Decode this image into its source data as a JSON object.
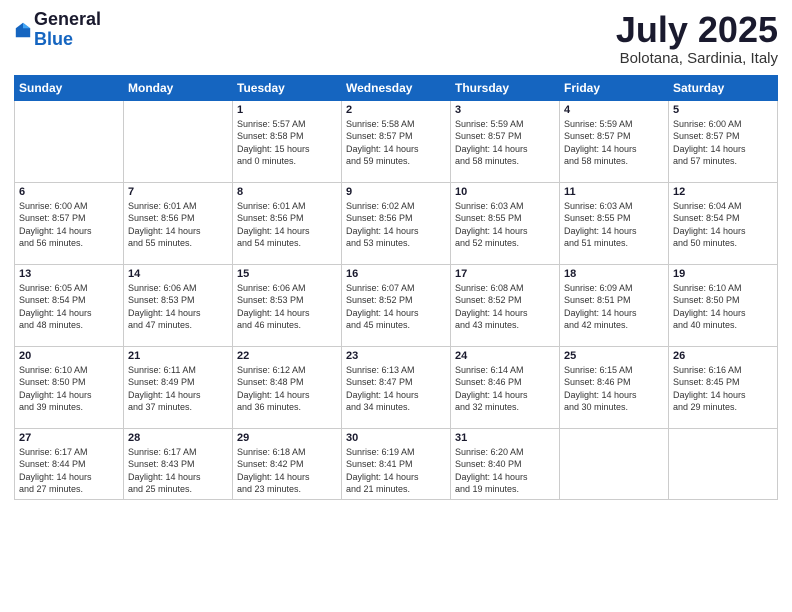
{
  "logo": {
    "general": "General",
    "blue": "Blue"
  },
  "title": "July 2025",
  "subtitle": "Bolotana, Sardinia, Italy",
  "weekdays": [
    "Sunday",
    "Monday",
    "Tuesday",
    "Wednesday",
    "Thursday",
    "Friday",
    "Saturday"
  ],
  "weeks": [
    [
      {
        "day": "",
        "info": ""
      },
      {
        "day": "",
        "info": ""
      },
      {
        "day": "1",
        "info": "Sunrise: 5:57 AM\nSunset: 8:58 PM\nDaylight: 15 hours\nand 0 minutes."
      },
      {
        "day": "2",
        "info": "Sunrise: 5:58 AM\nSunset: 8:57 PM\nDaylight: 14 hours\nand 59 minutes."
      },
      {
        "day": "3",
        "info": "Sunrise: 5:59 AM\nSunset: 8:57 PM\nDaylight: 14 hours\nand 58 minutes."
      },
      {
        "day": "4",
        "info": "Sunrise: 5:59 AM\nSunset: 8:57 PM\nDaylight: 14 hours\nand 58 minutes."
      },
      {
        "day": "5",
        "info": "Sunrise: 6:00 AM\nSunset: 8:57 PM\nDaylight: 14 hours\nand 57 minutes."
      }
    ],
    [
      {
        "day": "6",
        "info": "Sunrise: 6:00 AM\nSunset: 8:57 PM\nDaylight: 14 hours\nand 56 minutes."
      },
      {
        "day": "7",
        "info": "Sunrise: 6:01 AM\nSunset: 8:56 PM\nDaylight: 14 hours\nand 55 minutes."
      },
      {
        "day": "8",
        "info": "Sunrise: 6:01 AM\nSunset: 8:56 PM\nDaylight: 14 hours\nand 54 minutes."
      },
      {
        "day": "9",
        "info": "Sunrise: 6:02 AM\nSunset: 8:56 PM\nDaylight: 14 hours\nand 53 minutes."
      },
      {
        "day": "10",
        "info": "Sunrise: 6:03 AM\nSunset: 8:55 PM\nDaylight: 14 hours\nand 52 minutes."
      },
      {
        "day": "11",
        "info": "Sunrise: 6:03 AM\nSunset: 8:55 PM\nDaylight: 14 hours\nand 51 minutes."
      },
      {
        "day": "12",
        "info": "Sunrise: 6:04 AM\nSunset: 8:54 PM\nDaylight: 14 hours\nand 50 minutes."
      }
    ],
    [
      {
        "day": "13",
        "info": "Sunrise: 6:05 AM\nSunset: 8:54 PM\nDaylight: 14 hours\nand 48 minutes."
      },
      {
        "day": "14",
        "info": "Sunrise: 6:06 AM\nSunset: 8:53 PM\nDaylight: 14 hours\nand 47 minutes."
      },
      {
        "day": "15",
        "info": "Sunrise: 6:06 AM\nSunset: 8:53 PM\nDaylight: 14 hours\nand 46 minutes."
      },
      {
        "day": "16",
        "info": "Sunrise: 6:07 AM\nSunset: 8:52 PM\nDaylight: 14 hours\nand 45 minutes."
      },
      {
        "day": "17",
        "info": "Sunrise: 6:08 AM\nSunset: 8:52 PM\nDaylight: 14 hours\nand 43 minutes."
      },
      {
        "day": "18",
        "info": "Sunrise: 6:09 AM\nSunset: 8:51 PM\nDaylight: 14 hours\nand 42 minutes."
      },
      {
        "day": "19",
        "info": "Sunrise: 6:10 AM\nSunset: 8:50 PM\nDaylight: 14 hours\nand 40 minutes."
      }
    ],
    [
      {
        "day": "20",
        "info": "Sunrise: 6:10 AM\nSunset: 8:50 PM\nDaylight: 14 hours\nand 39 minutes."
      },
      {
        "day": "21",
        "info": "Sunrise: 6:11 AM\nSunset: 8:49 PM\nDaylight: 14 hours\nand 37 minutes."
      },
      {
        "day": "22",
        "info": "Sunrise: 6:12 AM\nSunset: 8:48 PM\nDaylight: 14 hours\nand 36 minutes."
      },
      {
        "day": "23",
        "info": "Sunrise: 6:13 AM\nSunset: 8:47 PM\nDaylight: 14 hours\nand 34 minutes."
      },
      {
        "day": "24",
        "info": "Sunrise: 6:14 AM\nSunset: 8:46 PM\nDaylight: 14 hours\nand 32 minutes."
      },
      {
        "day": "25",
        "info": "Sunrise: 6:15 AM\nSunset: 8:46 PM\nDaylight: 14 hours\nand 30 minutes."
      },
      {
        "day": "26",
        "info": "Sunrise: 6:16 AM\nSunset: 8:45 PM\nDaylight: 14 hours\nand 29 minutes."
      }
    ],
    [
      {
        "day": "27",
        "info": "Sunrise: 6:17 AM\nSunset: 8:44 PM\nDaylight: 14 hours\nand 27 minutes."
      },
      {
        "day": "28",
        "info": "Sunrise: 6:17 AM\nSunset: 8:43 PM\nDaylight: 14 hours\nand 25 minutes."
      },
      {
        "day": "29",
        "info": "Sunrise: 6:18 AM\nSunset: 8:42 PM\nDaylight: 14 hours\nand 23 minutes."
      },
      {
        "day": "30",
        "info": "Sunrise: 6:19 AM\nSunset: 8:41 PM\nDaylight: 14 hours\nand 21 minutes."
      },
      {
        "day": "31",
        "info": "Sunrise: 6:20 AM\nSunset: 8:40 PM\nDaylight: 14 hours\nand 19 minutes."
      },
      {
        "day": "",
        "info": ""
      },
      {
        "day": "",
        "info": ""
      }
    ]
  ]
}
